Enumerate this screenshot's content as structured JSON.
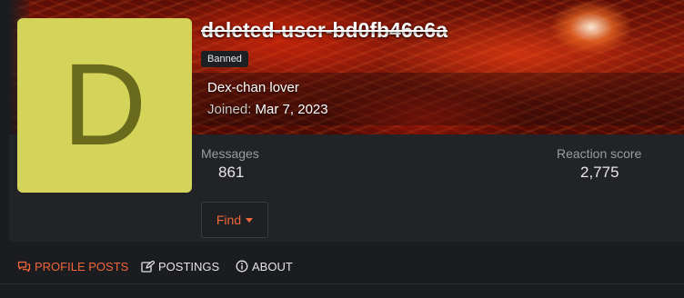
{
  "profile": {
    "avatar_letter": "D",
    "avatar_color": "#d4d45a",
    "username": "deleted-user-bd0fb46e6a",
    "badge": "Banned",
    "user_title": "Dex-chan lover",
    "joined_label": "Joined:",
    "joined_date": "Mar 7, 2023"
  },
  "stats": {
    "messages_label": "Messages",
    "messages_value": "861",
    "reaction_label": "Reaction score",
    "reaction_value": "2,775"
  },
  "actions": {
    "find_label": "Find"
  },
  "tabs": [
    {
      "label": "PROFILE POSTS",
      "icon": "comments-icon",
      "active": true
    },
    {
      "label": "POSTINGS",
      "icon": "edit-icon",
      "active": false
    },
    {
      "label": "ABOUT",
      "icon": "info-icon",
      "active": false
    }
  ],
  "colors": {
    "accent": "#f0653a",
    "background": "#1b1c1f"
  }
}
